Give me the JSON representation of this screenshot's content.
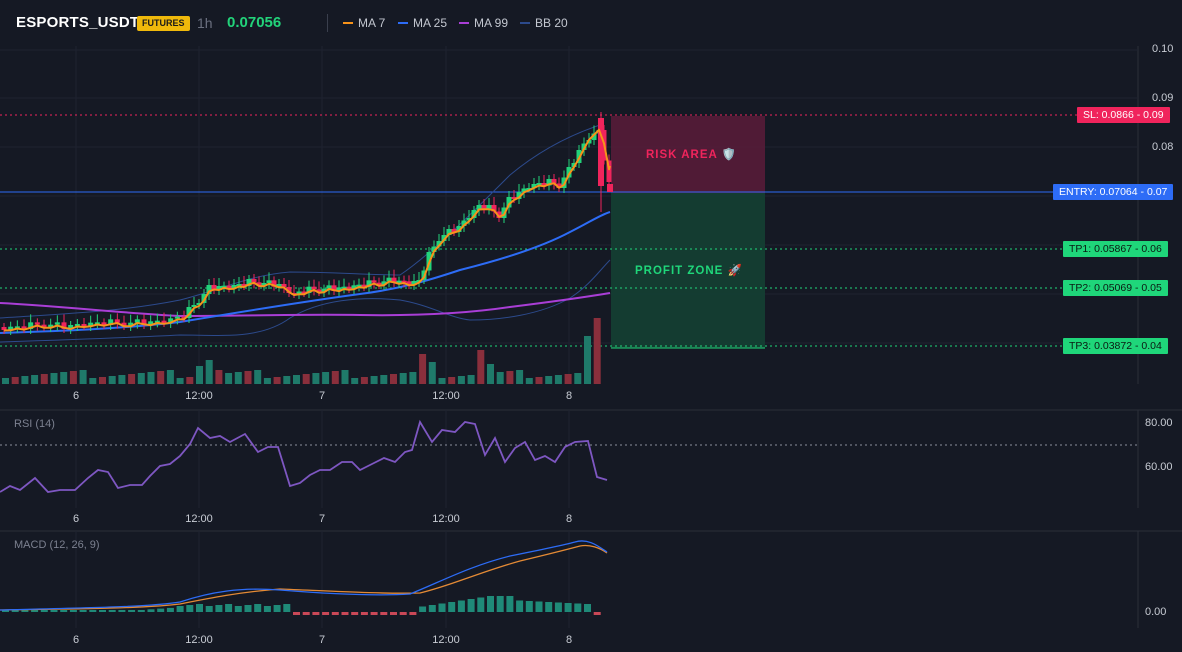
{
  "header": {
    "symbol": "ESPORTS_USDT",
    "badge": "FUTURES",
    "timeframe": "1h",
    "last_price": "0.07056",
    "indicators": [
      {
        "label": "MA 7",
        "color": "#f7931a"
      },
      {
        "label": "MA 25",
        "color": "#2d6cf6"
      },
      {
        "label": "MA 99",
        "color": "#a93ed6"
      },
      {
        "label": "BB 20",
        "color": "#2c4a8c"
      }
    ]
  },
  "main_axis": {
    "ticks": [
      "0.10",
      "0.09",
      "0.08",
      "0.07",
      "0.06",
      "0.05",
      "0.04"
    ]
  },
  "levels": {
    "sl": {
      "label": "SL: 0.0866",
      "axis": "0.09",
      "color": "#f0245c"
    },
    "entry": {
      "label": "ENTRY: 0.07064",
      "axis": "0.07",
      "color": "#2d6cf6"
    },
    "tp1": {
      "label": "TP1: 0.05867",
      "axis": "0.06",
      "color": "#1fd67a"
    },
    "tp2": {
      "label": "TP2: 0.05069",
      "axis": "0.05",
      "color": "#1fd67a"
    },
    "tp3": {
      "label": "TP3: 0.03872",
      "axis": "0.04",
      "color": "#1fd67a"
    }
  },
  "zones": {
    "risk": "RISK AREA 🛡️",
    "profit": "PROFIT ZONE 🚀"
  },
  "time_axis": [
    "6",
    "12:00",
    "7",
    "12:00",
    "8"
  ],
  "rsi": {
    "title": "RSI (14)",
    "ticks": [
      "80.00",
      "60.00"
    ]
  },
  "macd": {
    "title": "MACD (12, 26, 9)",
    "ticks": [
      "0.00"
    ]
  },
  "colors": {
    "up": "#22d37a",
    "down": "#f0245c",
    "vol_up": "#1f7a6a",
    "vol_down": "#8a2f3c"
  }
}
